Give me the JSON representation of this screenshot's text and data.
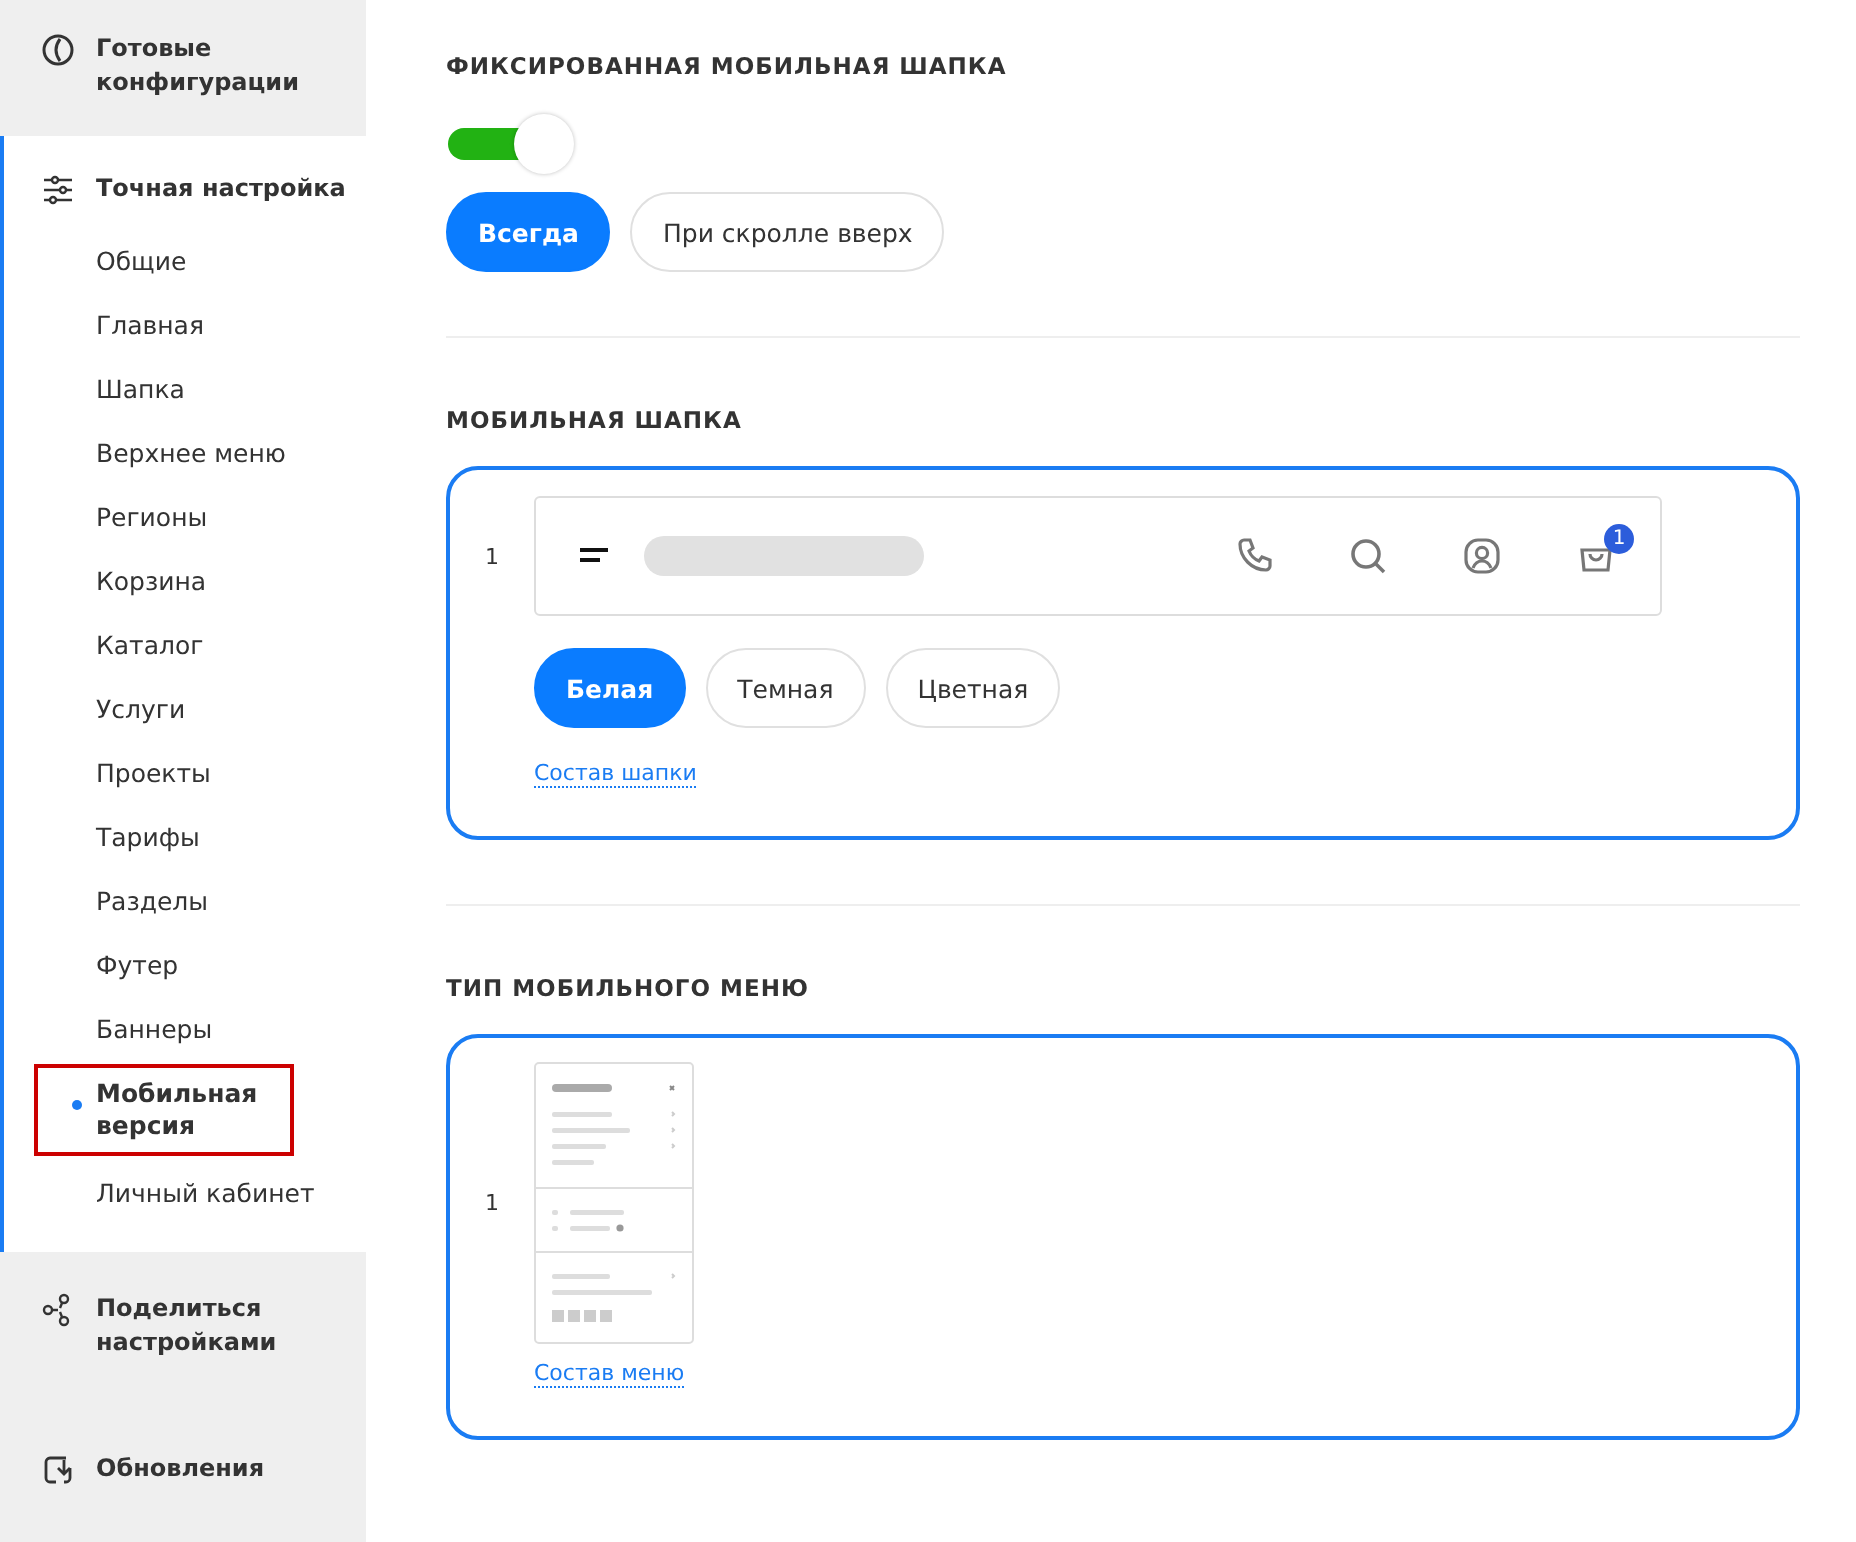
{
  "sidebar": {
    "sections": [
      {
        "kind": "presets",
        "label": "Готовые конфигурации",
        "expanded": false
      },
      {
        "kind": "tuning",
        "label": "Точная настройка",
        "expanded": true,
        "items": [
          {
            "label": "Общие",
            "selected": false
          },
          {
            "label": "Главная",
            "selected": false
          },
          {
            "label": "Шапка",
            "selected": false
          },
          {
            "label": "Верхнее меню",
            "selected": false
          },
          {
            "label": "Регионы",
            "selected": false
          },
          {
            "label": "Корзина",
            "selected": false
          },
          {
            "label": "Каталог",
            "selected": false
          },
          {
            "label": "Услуги",
            "selected": false
          },
          {
            "label": "Проекты",
            "selected": false
          },
          {
            "label": "Тарифы",
            "selected": false
          },
          {
            "label": "Разделы",
            "selected": false
          },
          {
            "label": "Футер",
            "selected": false
          },
          {
            "label": "Баннеры",
            "selected": false
          },
          {
            "label": "Мобильная версия",
            "selected": true
          },
          {
            "label": "Личный кабинет",
            "selected": false
          }
        ]
      },
      {
        "kind": "share",
        "label": "Поделиться настройками",
        "expanded": false
      },
      {
        "kind": "updates",
        "label": "Обновления",
        "expanded": false
      }
    ]
  },
  "fixed_header": {
    "title": "ФИКСИРОВАННАЯ МОБИЛЬНАЯ ШАПКА",
    "toggle": {
      "on": true
    },
    "options": [
      {
        "label": "Всегда",
        "selected": true
      },
      {
        "label": "При скролле вверх",
        "selected": false
      }
    ]
  },
  "mobile_header": {
    "title": "МОБИЛЬНАЯ ШАПКА",
    "variant": {
      "number": "1",
      "selected": true,
      "cart_badge": "1",
      "themes": [
        {
          "label": "Белая",
          "selected": true
        },
        {
          "label": "Темная",
          "selected": false
        },
        {
          "label": "Цветная",
          "selected": false
        }
      ],
      "link": "Состав шапки"
    }
  },
  "mobile_menu": {
    "title": "ТИП МОБИЛЬНОГО МЕНЮ",
    "variant": {
      "number": "1",
      "selected": true,
      "link": "Состав меню"
    }
  }
}
